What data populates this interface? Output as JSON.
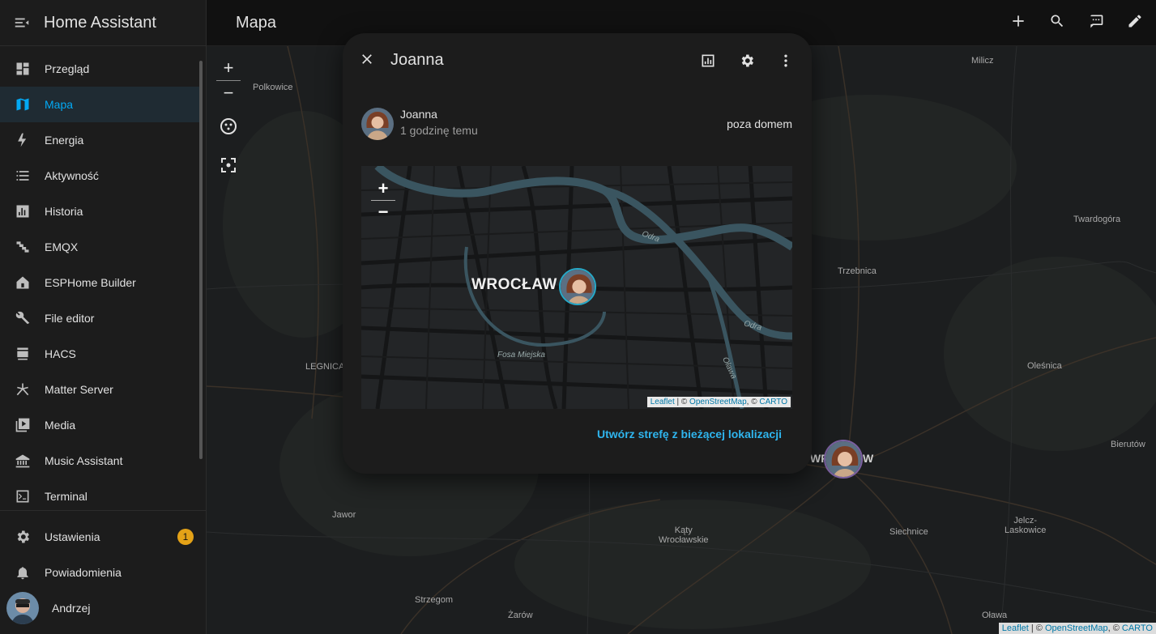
{
  "app": {
    "title": "Home Assistant",
    "page_title": "Mapa"
  },
  "sidebar": {
    "items": [
      {
        "label": "Przegląd",
        "icon": "dashboard-icon"
      },
      {
        "label": "Mapa",
        "icon": "map-icon"
      },
      {
        "label": "Energia",
        "icon": "lightning-icon"
      },
      {
        "label": "Aktywność",
        "icon": "list-icon"
      },
      {
        "label": "Historia",
        "icon": "chart-bar-icon"
      },
      {
        "label": "EMQX",
        "icon": "emqx-icon"
      },
      {
        "label": "ESPHome Builder",
        "icon": "esphome-icon"
      },
      {
        "label": "File editor",
        "icon": "wrench-icon"
      },
      {
        "label": "HACS",
        "icon": "hacs-icon"
      },
      {
        "label": "Matter Server",
        "icon": "matter-icon"
      },
      {
        "label": "Media",
        "icon": "media-icon"
      },
      {
        "label": "Music Assistant",
        "icon": "music-assistant-icon"
      },
      {
        "label": "Terminal",
        "icon": "terminal-icon"
      }
    ],
    "settings_label": "Ustawienia",
    "settings_badge": "1",
    "notifications_label": "Powiadomienia",
    "user_name": "Andrzej"
  },
  "map": {
    "labels": [
      "Polkowice",
      "Milicz",
      "Twardogóra",
      "Trzebnica",
      "Oleśnica",
      "LEGNICA",
      "Jawor",
      "Kąty\nWrocławskie",
      "Siechnice",
      "Jelcz-\nLaskowice",
      "Bierutów",
      "Strzegom",
      "Żarów",
      "Oława",
      "WR",
      "W"
    ],
    "attribution": {
      "leaflet": "Leaflet",
      "sep1": " | © ",
      "osm": "OpenStreetMap",
      "sep2": ", © ",
      "carto": "CARTO"
    }
  },
  "dialog": {
    "title": "Joanna",
    "entity_name": "Joanna",
    "entity_sub": "1 godzinę temu",
    "entity_state": "poza domem",
    "city_label": "WROCŁAW",
    "river_labels": [
      "Odra",
      "Odra",
      "Oława",
      "Fosa Miejska"
    ],
    "create_zone_link": "Utwórz strefę z bieżącej lokalizacji"
  }
}
